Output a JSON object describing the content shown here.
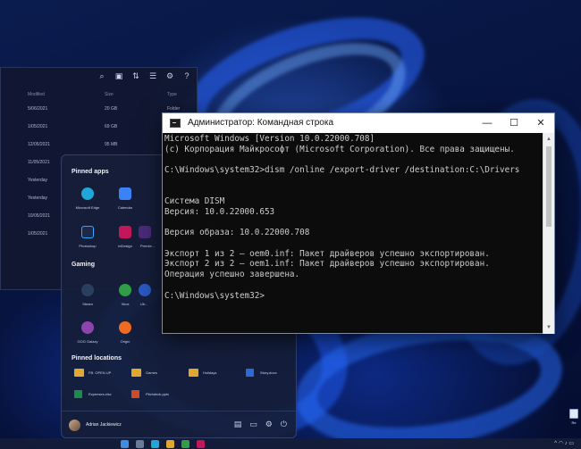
{
  "explorer": {
    "headers": {
      "modified": "Modified",
      "size": "Size",
      "type": "Type"
    },
    "rows": [
      {
        "modified": "5/06/2021",
        "size": "20 GB",
        "type": "Folder"
      },
      {
        "modified": "1/05/2021",
        "size": "69 GB",
        "type": ""
      },
      {
        "modified": "12/05/2021",
        "size": "95 MB",
        "type": ""
      },
      {
        "modified": "11/05/2021",
        "size": "",
        "type": ""
      },
      {
        "modified": "Yesterday",
        "size": "",
        "type": ""
      },
      {
        "modified": "Yesterday",
        "size": "",
        "type": ""
      },
      {
        "modified": "10/05/2021",
        "size": "",
        "type": ""
      },
      {
        "modified": "1/05/2021",
        "size": "",
        "type": ""
      }
    ]
  },
  "start_menu": {
    "pinned_title": "Pinned apps",
    "pinned": [
      {
        "label": "Microsoft Edge",
        "color": "#1ea7d8"
      },
      {
        "label": "Calendar",
        "color": "#3b82f6"
      },
      {
        "label": "Photoshop",
        "color": "#1b2a4a"
      },
      {
        "label": "InDesign",
        "color": "#c2185b"
      },
      {
        "label": "Premie...",
        "color": "#4a2a7a"
      }
    ],
    "gaming_title": "Gaming",
    "gaming": [
      {
        "label": "Steam",
        "color": "#2a3f5f"
      },
      {
        "label": "Xbox",
        "color": "#2f9e44"
      },
      {
        "label": "GOG Galaxy",
        "color": "#8e44ad"
      },
      {
        "label": "Origin",
        "color": "#f06a20"
      },
      {
        "label": "Ub...",
        "color": "#2b59c3"
      }
    ],
    "locations_title": "Pinned locations",
    "locations": [
      {
        "label": "FB. OPEN UP",
        "color": "#e0a82e"
      },
      {
        "label": "Games",
        "color": "#e0a82e"
      },
      {
        "label": "Holidays",
        "color": "#e0a82e"
      },
      {
        "label": "Story.docx",
        "color": "#2b6cd4"
      },
      {
        "label": "Expenses.xlsx",
        "color": "#1f8a4c"
      },
      {
        "label": "Pitchdeck.pptx",
        "color": "#d04a2a"
      }
    ],
    "user_name": "Adrian Jackiewicz"
  },
  "cmd": {
    "title": "Администратор: Командная строка",
    "lines": [
      "Microsoft Windows [Version 10.0.22000.708]",
      "(c) Корпорация Майкрософт (Microsoft Corporation). Все права защищены.",
      "",
      "C:\\Windows\\system32>dism /online /export-driver /destination:C:\\Drivers",
      "",
      "",
      "Система DISM",
      "Версия: 10.0.22000.653",
      "",
      "Версия образа: 10.0.22000.708",
      "",
      "Экспорт 1 из 2 — oem0.inf: Пакет драйверов успешно экспортирован.",
      "Экспорт 2 из 2 — oem1.inf: Пакет драйверов успешно экспортирован.",
      "Операция успешно завершена.",
      "",
      "C:\\Windows\\system32>"
    ]
  },
  "desktop": {
    "recycle_label": "Re"
  }
}
